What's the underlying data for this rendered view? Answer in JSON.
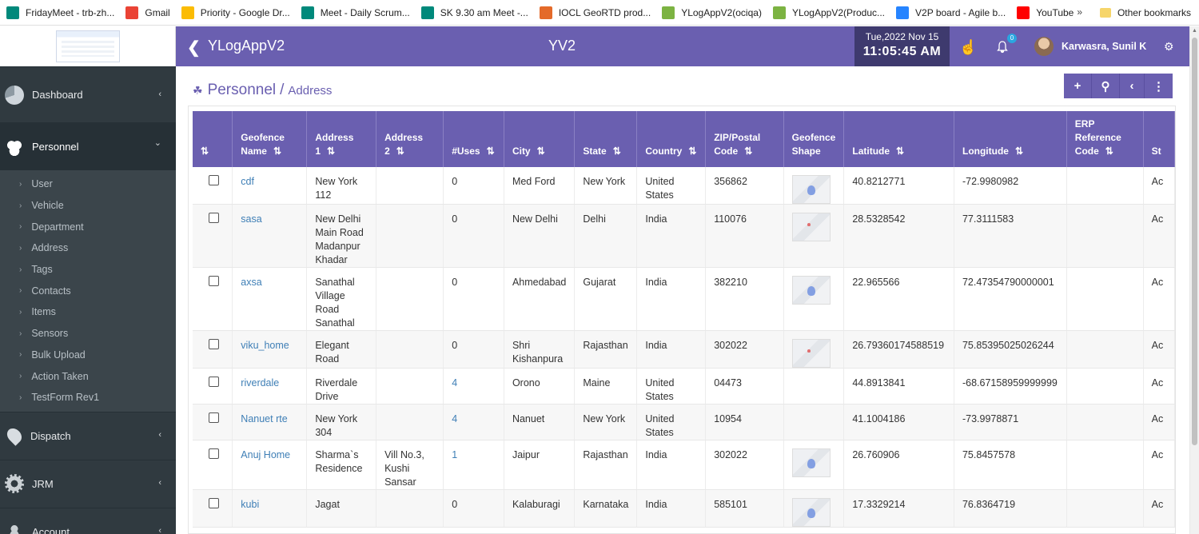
{
  "bookmarks": {
    "items": [
      {
        "label": "FridayMeet - trb-zh...",
        "icon": "meet-icon",
        "color": "#00897b"
      },
      {
        "label": "Gmail",
        "icon": "gmail-icon",
        "color": "#ea4335"
      },
      {
        "label": "Priority - Google Dr...",
        "icon": "drive-icon",
        "color": "#fbbc04"
      },
      {
        "label": "Meet - Daily Scrum...",
        "icon": "meet-icon",
        "color": "#00897b"
      },
      {
        "label": "SK 9.30 am Meet -...",
        "icon": "meet-icon",
        "color": "#00897b"
      },
      {
        "label": "IOCL GeoRTD prod...",
        "icon": "iocl-icon",
        "color": "#e46a2a"
      },
      {
        "label": "YLogAppV2(ociqa)",
        "icon": "ylog-icon",
        "color": "#7cb342"
      },
      {
        "label": "YLogAppV2(Produc...",
        "icon": "ylog-icon",
        "color": "#7cb342"
      },
      {
        "label": "V2P board - Agile b...",
        "icon": "jira-icon",
        "color": "#2684ff"
      },
      {
        "label": "YouTube",
        "icon": "youtube-icon",
        "color": "#ff0000"
      }
    ],
    "more": "»",
    "other": "Other bookmarks"
  },
  "sidebar": {
    "main_items": [
      {
        "label": "Dashboard",
        "icon": "dashboard-icon",
        "chevron": "‹"
      },
      {
        "label": "Personnel",
        "icon": "personnel-icon",
        "chevron": "⌄"
      },
      {
        "label": "Dispatch",
        "icon": "location-pin-icon",
        "chevron": "‹"
      },
      {
        "label": "JRM",
        "icon": "gear-icon",
        "chevron": "‹"
      },
      {
        "label": "Account",
        "icon": "account-icon",
        "chevron": "‹"
      }
    ],
    "sub_items": [
      "User",
      "Vehicle",
      "Department",
      "Address",
      "Tags",
      "Contacts",
      "Items",
      "Sensors",
      "Bulk Upload",
      "Action Taken",
      "TestForm Rev1"
    ]
  },
  "header": {
    "back": "❮",
    "app_title": "YLogAppV2",
    "center_title": "YV2",
    "date": "Tue,2022 Nov 15",
    "time": "11:05:45 AM",
    "bell_count": "0",
    "user_name": "Karwasra, Sunil K"
  },
  "breadcrumb": {
    "section": "Personnel",
    "sep": "/",
    "page": "Address"
  },
  "actions": [
    "+",
    "⚲",
    "‹",
    "⋮"
  ],
  "table": {
    "headers": [
      {
        "label": "",
        "sort": "⇅"
      },
      {
        "label": "Geofence Name",
        "sort": "⇅"
      },
      {
        "label": "Address 1",
        "sort": "⇅"
      },
      {
        "label": "Address 2",
        "sort": "⇅"
      },
      {
        "label": "#Uses",
        "sort": "⇅"
      },
      {
        "label": "City",
        "sort": "⇅"
      },
      {
        "label": "State",
        "sort": "⇅"
      },
      {
        "label": "Country",
        "sort": "⇅"
      },
      {
        "label": "ZIP/Postal Code",
        "sort": "⇅"
      },
      {
        "label": "Geofence Shape",
        "sort": ""
      },
      {
        "label": "Latitude",
        "sort": "⇅"
      },
      {
        "label": "Longitude",
        "sort": "⇅"
      },
      {
        "label": "ERP Reference Code",
        "sort": "⇅"
      },
      {
        "label": "St",
        "sort": ""
      }
    ],
    "rows": [
      {
        "name": "cdf",
        "addr1": "New York 112",
        "addr2": "",
        "uses": "0",
        "uses_link": false,
        "city": "Med Ford",
        "state": "New York",
        "country": "United States",
        "zip": "356862",
        "shape": "blue",
        "lat": "40.8212771",
        "lng": "-72.9980982",
        "erp": "",
        "status": "Ac"
      },
      {
        "name": "sasa",
        "addr1": "New Delhi Main Road Madanpur Khadar",
        "addr2": "",
        "uses": "0",
        "uses_link": false,
        "city": "New Delhi",
        "state": "Delhi",
        "country": "India",
        "zip": "110076",
        "shape": "red",
        "lat": "28.5328542",
        "lng": "77.3111583",
        "erp": "",
        "status": "Ac"
      },
      {
        "name": "axsa",
        "addr1": "Sanathal Village Road Sanathal",
        "addr2": "",
        "uses": "0",
        "uses_link": false,
        "city": "Ahmedabad",
        "state": "Gujarat",
        "country": "India",
        "zip": "382210",
        "shape": "blue",
        "lat": "22.965566",
        "lng": "72.47354790000001",
        "erp": "",
        "status": "Ac"
      },
      {
        "name": "viku_home",
        "addr1": "Elegant Road",
        "addr2": "",
        "uses": "0",
        "uses_link": false,
        "city": "Shri Kishanpura",
        "state": "Rajasthan",
        "country": "India",
        "zip": "302022",
        "shape": "red",
        "lat": "26.79360174588519",
        "lng": "75.85395025026244",
        "erp": "",
        "status": "Ac"
      },
      {
        "name": "riverdale",
        "addr1": "Riverdale Drive",
        "addr2": "",
        "uses": "4",
        "uses_link": true,
        "city": "Orono",
        "state": "Maine",
        "country": "United States",
        "zip": "04473",
        "shape": "",
        "lat": "44.8913841",
        "lng": "-68.67158959999999",
        "erp": "",
        "status": "Ac"
      },
      {
        "name": "Nanuet rte",
        "addr1": "New York 304",
        "addr2": "",
        "uses": "4",
        "uses_link": true,
        "city": "Nanuet",
        "state": "New York",
        "country": "United States",
        "zip": "10954",
        "shape": "",
        "lat": "41.1004186",
        "lng": "-73.9978871",
        "erp": "",
        "status": "Ac"
      },
      {
        "name": "Anuj Home",
        "addr1": "Sharma`s Residence",
        "addr2": "Vill No.3, Kushi Sansar",
        "uses": "1",
        "uses_link": true,
        "city": "Jaipur",
        "state": "Rajasthan",
        "country": "India",
        "zip": "302022",
        "shape": "blue",
        "lat": "26.760906",
        "lng": "75.8457578",
        "erp": "",
        "status": "Ac"
      },
      {
        "name": "kubi",
        "addr1": "Jagat",
        "addr2": "",
        "uses": "0",
        "uses_link": false,
        "city": "Kalaburagi",
        "state": "Karnataka",
        "country": "India",
        "zip": "585101",
        "shape": "blue",
        "lat": "17.3329214",
        "lng": "76.8364719",
        "erp": "",
        "status": "Ac"
      }
    ]
  }
}
